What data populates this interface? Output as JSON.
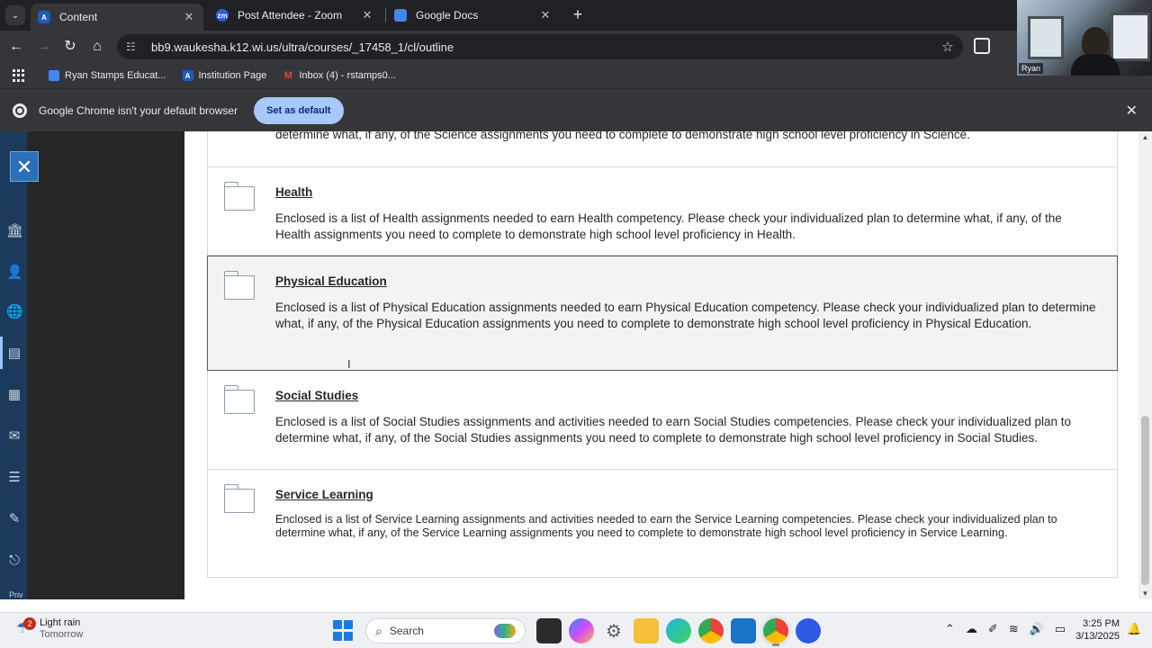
{
  "browser": {
    "tabs": [
      {
        "title": "Content",
        "favicon": "A",
        "favicon_color": "#1f5cb8",
        "active": true
      },
      {
        "title": "Post Attendee - Zoom",
        "favicon": "zm",
        "favicon_color": "#2d5be3",
        "active": false
      },
      {
        "title": "Google Docs",
        "favicon": "",
        "favicon_color": "#4285f4",
        "active": false
      }
    ],
    "url": "bb9.waukesha.k12.wi.us/ultra/courses/_17458_1/cl/outline",
    "bookmarks": [
      {
        "label": "Ryan Stamps Educat...",
        "icon_color": "#4285f4",
        "icon": ""
      },
      {
        "label": "Institution Page",
        "icon_color": "#1f5cb8",
        "icon": "A"
      },
      {
        "label": "Inbox (4) - rstamps0...",
        "icon_color": "#ea4335",
        "icon": "M"
      }
    ],
    "infobar": {
      "message": "Google Chrome isn't your default browser",
      "button": "Set as default"
    }
  },
  "webcam": {
    "name": "Ryan"
  },
  "course": {
    "top_fragment": "determine what, if any, of the Science assignments you need to complete to demonstrate high school level proficiency in Science.",
    "items": [
      {
        "title": "Health",
        "description": "Enclosed is a list of Health assignments needed to earn Health competency. Please check your individualized plan to determine what, if any, of the Health assignments you need to complete to demonstrate high school level proficiency in Health."
      },
      {
        "title": "Physical Education",
        "description": "Enclosed is a list of Physical Education assignments needed to earn Physical Education competency. Please check your individualized plan to determine what, if any, of the Physical Education assignments you need to complete to demonstrate high school level proficiency in Physical Education."
      },
      {
        "title": "Social Studies",
        "description": "Enclosed is a list of Social Studies assignments and activities needed to earn Social Studies competencies. Please check your individualized plan to determine what, if any, of the Social Studies assignments you need to complete to demonstrate high school level proficiency in Social Studies."
      },
      {
        "title": "Service Learning",
        "description": "Enclosed is a list of Service Learning assignments and activities needed to earn the Service Learning competencies. Please check your individualized plan to determine what, if any, of the Service Learning assignments you need to complete to demonstrate high school level proficiency in Service Learning."
      }
    ],
    "rail_footer": "Priv"
  },
  "taskbar": {
    "weather_badge": "2",
    "weather_title": "Light rain",
    "weather_sub": "Tomorrow",
    "search_placeholder": "Search",
    "time": "3:25 PM",
    "date": "3/13/2025"
  }
}
